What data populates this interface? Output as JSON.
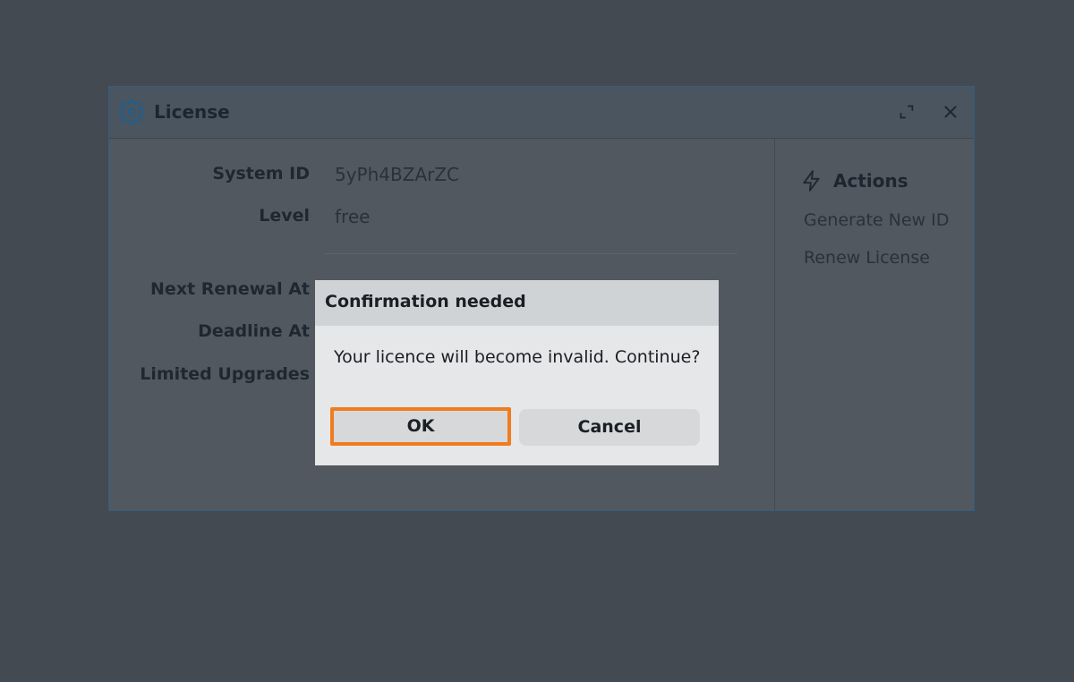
{
  "window": {
    "title": "License",
    "icon": "gear-icon",
    "controls": [
      "expand-icon",
      "close-icon"
    ]
  },
  "details": [
    {
      "label": "System ID",
      "value": "5yPh4BZArZC"
    },
    {
      "label": "Level",
      "value": "free"
    },
    {
      "label": "Next Renewal At",
      "value": ""
    },
    {
      "label": "Deadline At",
      "value": ""
    },
    {
      "label": "Limited Upgrades",
      "value": ""
    }
  ],
  "actions": {
    "title": "Actions",
    "icon": "bolt-icon",
    "items": [
      "Generate New ID",
      "Renew License"
    ]
  },
  "dialog": {
    "title": "Confirmation needed",
    "message": "Your licence will become invalid. Continue?",
    "ok_label": "OK",
    "cancel_label": "Cancel"
  },
  "colors": {
    "focus_outline": "#f07c1e",
    "window_border": "#2f5f86"
  }
}
